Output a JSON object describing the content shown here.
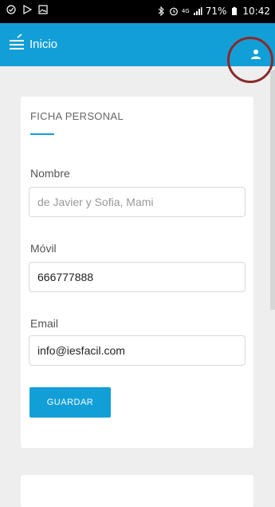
{
  "status_bar": {
    "battery_percent": "71%",
    "time": "10:42",
    "network": "4G"
  },
  "app_bar": {
    "title": "Inicio",
    "menu_icon": "hamburger-menu-icon",
    "user_icon": "user-icon",
    "color": "#129fd8"
  },
  "card": {
    "title": "FICHA PERSONAL",
    "fields": [
      {
        "label": "Nombre",
        "value": "",
        "placeholder": "de Javier y Sofia, Mami"
      },
      {
        "label": "Móvil",
        "value": "666777888",
        "placeholder": ""
      },
      {
        "label": "Email",
        "value": "info@iesfacil.com",
        "placeholder": ""
      }
    ],
    "save_label": "GUARDAR"
  }
}
